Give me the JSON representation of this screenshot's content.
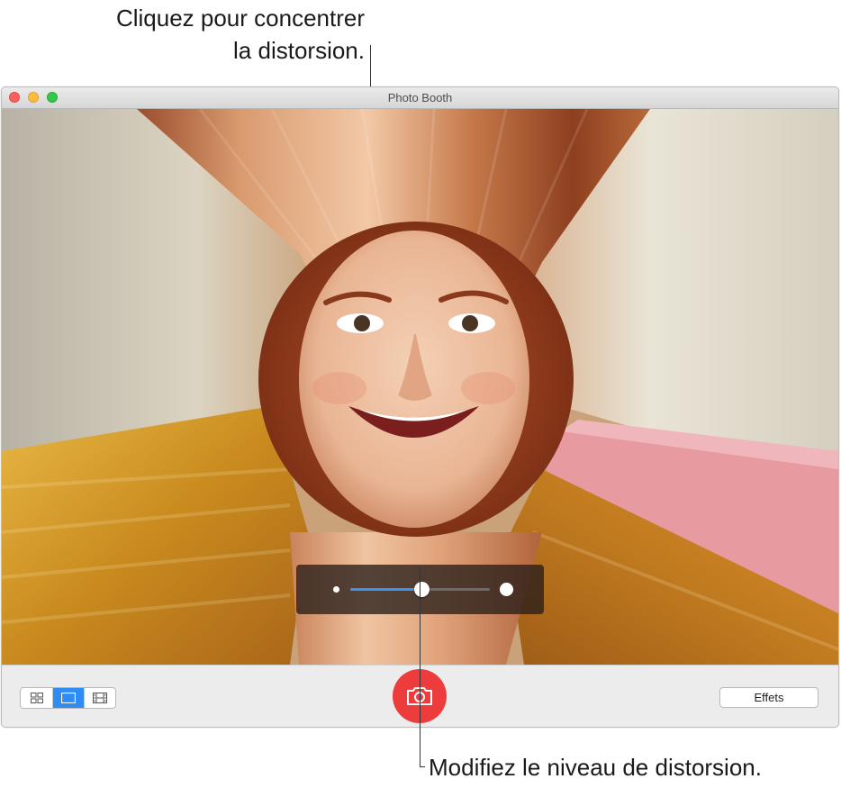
{
  "callouts": {
    "top_line1": "Cliquez pour concentrer",
    "top_line2": "la distorsion.",
    "bottom": "Modifiez le niveau de distorsion."
  },
  "window": {
    "title": "Photo Booth",
    "traffic_lights": [
      "close-button",
      "minimize-button",
      "zoom-button"
    ]
  },
  "distortion_slider": {
    "level_fraction": 0.51,
    "min_icon": "small-dot-icon",
    "max_icon": "large-dot-icon",
    "fill_color": "#3d93f0"
  },
  "toolbar": {
    "view_modes": [
      {
        "icon": "four-up-grid-icon",
        "active": false
      },
      {
        "icon": "single-photo-icon",
        "active": true
      },
      {
        "icon": "filmstrip-icon",
        "active": false
      }
    ],
    "shutter_icon": "camera-icon",
    "shutter_color": "#ee3b3b",
    "effects_label": "Effets"
  },
  "colors": {
    "accent": "#2f8cf3"
  }
}
